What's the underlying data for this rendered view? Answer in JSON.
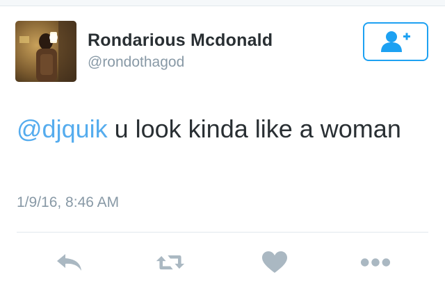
{
  "author": {
    "display_name": "Rondarious Mcdonald",
    "handle": "@rondothagod"
  },
  "tweet": {
    "mention": "@djquik",
    "text": " u look kinda like a woman",
    "timestamp": "1/9/16, 8:46 AM"
  },
  "actions": {
    "reply_icon": "reply-icon",
    "retweet_icon": "retweet-icon",
    "like_icon": "heart-icon",
    "more_icon": "more-icon",
    "follow_icon": "add-user-icon"
  },
  "colors": {
    "accent": "#1da1f2",
    "mention": "#55acee",
    "text": "#292f33",
    "secondary": "#8899a6",
    "icon": "#aab8c2"
  }
}
